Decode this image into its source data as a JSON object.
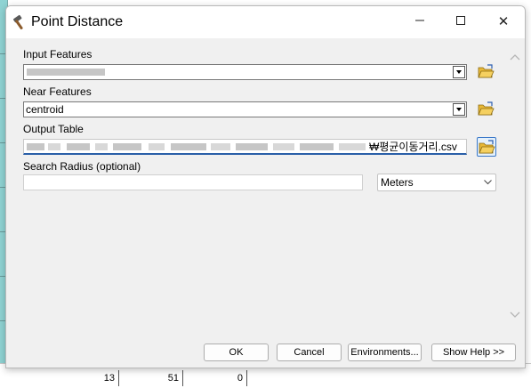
{
  "window": {
    "title": "Point Distance"
  },
  "controls": {
    "close_glyph": "✕"
  },
  "input_features": {
    "label": "Input Features",
    "value": ""
  },
  "near_features": {
    "label": "Near Features",
    "value": "centroid"
  },
  "output_table": {
    "label": "Output Table",
    "value_suffix": "₩평균이동거리.csv"
  },
  "search_radius": {
    "label": "Search Radius (optional)",
    "value": "",
    "unit": "Meters"
  },
  "buttons": {
    "ok": "OK",
    "cancel": "Cancel",
    "environments": "Environments...",
    "show_help": "Show Help >>"
  },
  "background_table": {
    "cells": [
      "13",
      "51",
      "0"
    ]
  },
  "icons": {
    "app": "hammer-icon",
    "folder": "open-folder-icon",
    "minimize": "minimize-icon",
    "maximize": "maximize-icon",
    "close": "close-icon"
  }
}
